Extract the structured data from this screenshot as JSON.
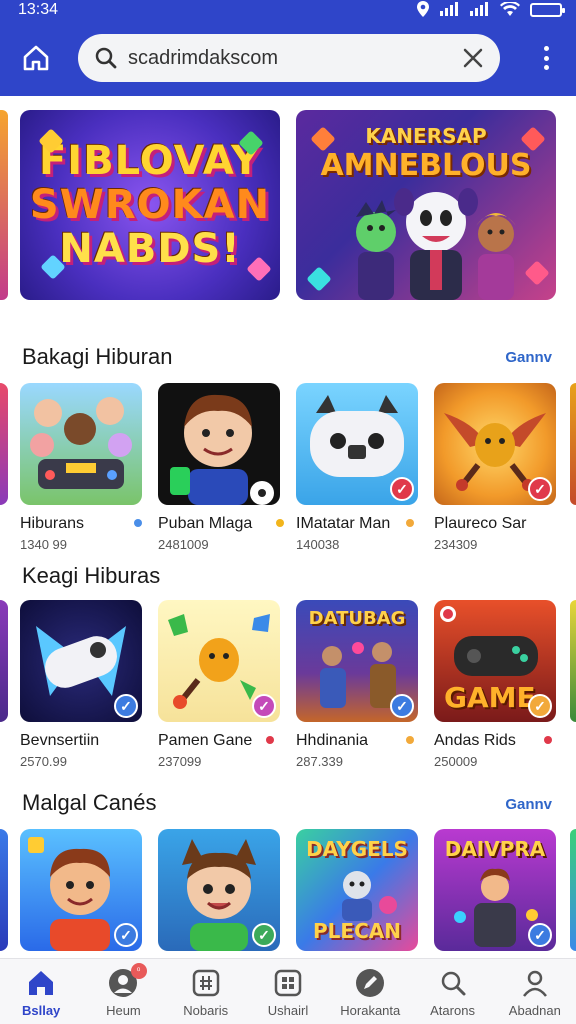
{
  "status": {
    "time": "13:34"
  },
  "search": {
    "value": "scadrimdakscom"
  },
  "banners": [
    {
      "lines": [
        "FIBLOVAY",
        "SWROKAN",
        "NABDS!"
      ]
    },
    {
      "line1": "KANERSAP",
      "line2": "AMNEBLOUS"
    }
  ],
  "sections": [
    {
      "title": "Bakagi Hiburan",
      "more": "Gannv",
      "items": [
        {
          "title": "Hiburans",
          "count": "1340 99",
          "dot": "#4a8ee8",
          "badge": "",
          "badge_color": ""
        },
        {
          "title": "Puban Mlaga",
          "count": "2481009",
          "dot": "#f2b51c",
          "badge": "",
          "badge_color": ""
        },
        {
          "title": "IMatatar Man",
          "count": "140038",
          "dot": "#f2a93a",
          "badge": "✓",
          "badge_color": "#e0394a"
        },
        {
          "title": "Plaureco Sar",
          "count": "234309",
          "dot": "",
          "badge": "✓",
          "badge_color": "#e0394a"
        }
      ]
    },
    {
      "title": "Keagi Hiburas",
      "more": "",
      "items": [
        {
          "title": "Bevnsertiin",
          "count": "2570.99",
          "dot": "",
          "badge": "✓",
          "badge_color": "#3c7be0"
        },
        {
          "title": "Pamen Gane",
          "count": "237099",
          "dot": "#e0394a",
          "badge": "✓",
          "badge_color": "#c44ab9"
        },
        {
          "title": "Hhdinania",
          "count": "287.339",
          "dot": "#f2a93a",
          "badge": "✓",
          "badge_color": "#3c7be0"
        },
        {
          "title": "Andas Rids",
          "count": "250009",
          "dot": "#e0394a",
          "badge": "✓",
          "badge_color": "#f2a93a"
        }
      ],
      "game_text": "GAME",
      "thumb_text": "DATUBAG"
    },
    {
      "title": "Malgal Canés",
      "more": "Gannv",
      "items": [
        {
          "badge": "✓",
          "badge_color": "#3c7be0"
        },
        {
          "badge": "✓",
          "badge_color": "#3caa5a"
        },
        {
          "badge": "",
          "badge_color": ""
        },
        {
          "badge": "✓",
          "badge_color": "#3c7be0"
        }
      ],
      "thumb3_top": "DAYGELS",
      "thumb3_bottom": "PLECAN",
      "thumb4_top": "DAIVPRA"
    }
  ],
  "nav": [
    {
      "label": "Bsllay",
      "icon": "home-icon",
      "active": true
    },
    {
      "label": "Heum",
      "icon": "profile-icon",
      "badge": "⁰"
    },
    {
      "label": "Nobaris",
      "icon": "grid-square-icon"
    },
    {
      "label": "Ushairl",
      "icon": "apps-icon"
    },
    {
      "label": "Horakanta",
      "icon": "edit-circle-icon"
    },
    {
      "label": "Atarons",
      "icon": "search-icon"
    },
    {
      "label": "Abadnan",
      "icon": "account-icon"
    }
  ],
  "colors": {
    "brand": "#2f45c9",
    "accent_link": "#2f66c9"
  }
}
